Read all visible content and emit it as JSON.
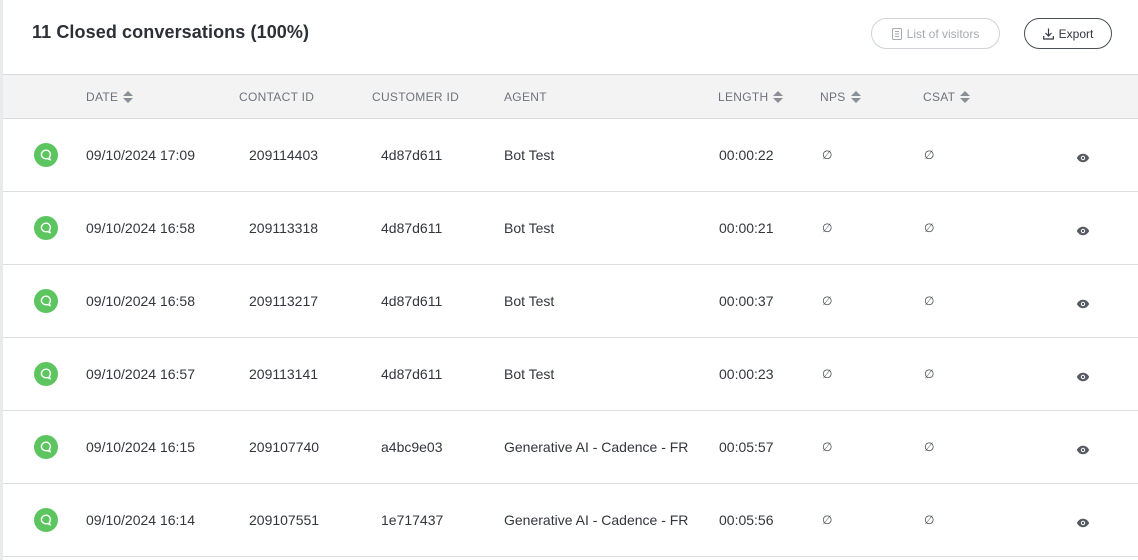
{
  "header": {
    "title": "11 Closed conversations (100%)",
    "visitors_label": "List of visitors",
    "export_label": "Export"
  },
  "columns": {
    "date": "DATE",
    "contact_id": "CONTACT ID",
    "customer_id": "CUSTOMER ID",
    "agent": "AGENT",
    "length": "LENGTH",
    "nps": "NPS",
    "csat": "CSAT"
  },
  "rows": [
    {
      "date": "09/10/2024 17:09",
      "contact_id": "209114403",
      "customer_id": "4d87d611",
      "agent": "Bot Test",
      "length": "00:00:22",
      "nps": "∅",
      "csat": "∅"
    },
    {
      "date": "09/10/2024 16:58",
      "contact_id": "209113318",
      "customer_id": "4d87d611",
      "agent": "Bot Test",
      "length": "00:00:21",
      "nps": "∅",
      "csat": "∅"
    },
    {
      "date": "09/10/2024 16:58",
      "contact_id": "209113217",
      "customer_id": "4d87d611",
      "agent": "Bot Test",
      "length": "00:00:37",
      "nps": "∅",
      "csat": "∅"
    },
    {
      "date": "09/10/2024 16:57",
      "contact_id": "209113141",
      "customer_id": "4d87d611",
      "agent": "Bot Test",
      "length": "00:00:23",
      "nps": "∅",
      "csat": "∅"
    },
    {
      "date": "09/10/2024 16:15",
      "contact_id": "209107740",
      "customer_id": "a4bc9e03",
      "agent": "Generative AI - Cadence - FR",
      "length": "00:05:57",
      "nps": "∅",
      "csat": "∅"
    },
    {
      "date": "09/10/2024 16:14",
      "contact_id": "209107551",
      "customer_id": "1e717437",
      "agent": "Generative AI - Cadence - FR",
      "length": "00:05:56",
      "nps": "∅",
      "csat": "∅"
    }
  ],
  "colors": {
    "status_green": "#5cc55f",
    "header_bg": "#f3f3f4"
  },
  "icons": {
    "status": "chat-bubble-icon",
    "view": "eye-icon",
    "visitors": "document-list-icon",
    "export": "download-icon"
  }
}
